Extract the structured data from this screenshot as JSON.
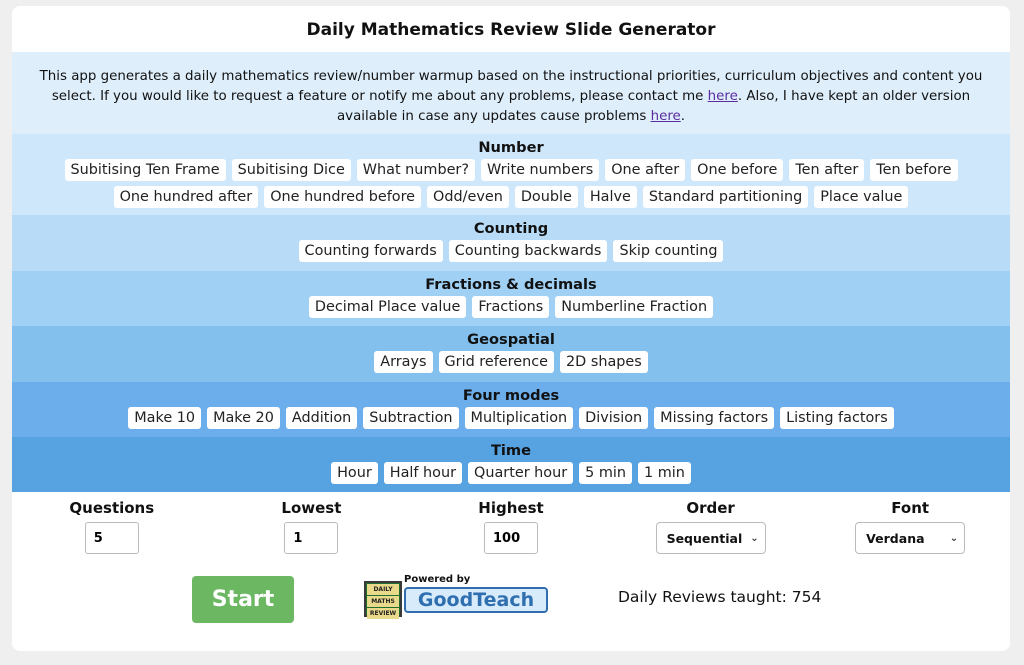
{
  "title": "Daily Mathematics Review Slide Generator",
  "intro": {
    "text1": "This app generates a daily mathematics review/number warmup based on the instructional priorities, curriculum objectives and content you select. If you would like to request a feature or notify me about any problems, please contact me ",
    "link1": "here",
    "text2": ". Also, I have kept an older version available in case any updates cause problems ",
    "link2": "here",
    "text3": "."
  },
  "sections": [
    {
      "title": "Number",
      "items": [
        "Subitising Ten Frame",
        "Subitising Dice",
        "What number?",
        "Write numbers",
        "One after",
        "One before",
        "Ten after",
        "Ten before",
        "One hundred after",
        "One hundred before",
        "Odd/even",
        "Double",
        "Halve",
        "Standard partitioning",
        "Place value"
      ]
    },
    {
      "title": "Counting",
      "items": [
        "Counting forwards",
        "Counting backwards",
        "Skip counting"
      ]
    },
    {
      "title": "Fractions & decimals",
      "items": [
        "Decimal Place value",
        "Fractions",
        "Numberline Fraction"
      ]
    },
    {
      "title": "Geospatial",
      "items": [
        "Arrays",
        "Grid reference",
        "2D shapes"
      ]
    },
    {
      "title": "Four modes",
      "items": [
        "Make 10",
        "Make 20",
        "Addition",
        "Subtraction",
        "Multiplication",
        "Division",
        "Missing factors",
        "Listing factors"
      ]
    },
    {
      "title": "Time",
      "items": [
        "Hour",
        "Half hour",
        "Quarter hour",
        "5 min",
        "1 min"
      ]
    }
  ],
  "controls": {
    "questions": {
      "label": "Questions",
      "value": "5"
    },
    "lowest": {
      "label": "Lowest",
      "value": "1"
    },
    "highest": {
      "label": "Highest",
      "value": "100"
    },
    "order": {
      "label": "Order",
      "value": "Sequential"
    },
    "font": {
      "label": "Font",
      "value": "Verdana"
    }
  },
  "start_label": "Start",
  "logo": {
    "powered": "Powered by",
    "brand": "GoodTeach",
    "badge": [
      "DAILY",
      "MATHS",
      "REVIEW"
    ]
  },
  "taught": "Daily Reviews taught: 754",
  "colors": {
    "start": "#6cb862",
    "link": "#5b2ca0",
    "brand": "#2f6fb0"
  }
}
